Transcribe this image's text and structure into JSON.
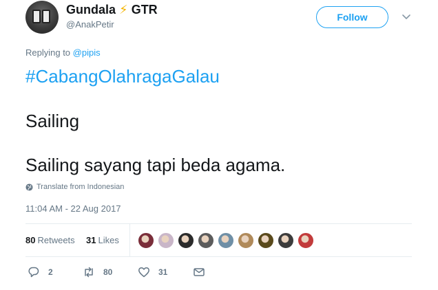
{
  "author": {
    "name": "Gundala",
    "emoji": "⚡",
    "name_suffix": "GTR",
    "handle": "@AnakPetir"
  },
  "follow_label": "Follow",
  "replying": {
    "prefix": "Replying to",
    "mention": "@pipis"
  },
  "tweet": {
    "hashtag": "#CabangOlahragaGalau",
    "line1": "Sailing",
    "line2": "Sailing sayang tapi beda agama."
  },
  "translate_label": "Translate from Indonesian",
  "timestamp": "11:04 AM - 22 Aug 2017",
  "stats": {
    "retweets_count": "80",
    "retweets_label": "Retweets",
    "likes_count": "31",
    "likes_label": "Likes"
  },
  "likers": [
    {
      "color": "#7a2e3a"
    },
    {
      "color": "#c9b6c8"
    },
    {
      "color": "#2b2b2b"
    },
    {
      "color": "#5c5c5c"
    },
    {
      "color": "#6f8fa6"
    },
    {
      "color": "#b08a5a"
    },
    {
      "color": "#5a4a1c"
    },
    {
      "color": "#3c3c3c"
    },
    {
      "color": "#c23b3b"
    }
  ],
  "actions": {
    "replies": "2",
    "retweets": "80",
    "likes": "31"
  },
  "icons": {
    "reply": "reply-icon",
    "retweet": "retweet-icon",
    "like": "heart-icon",
    "dm": "envelope-icon",
    "caret": "chevron-down-icon",
    "globe": "globe-icon"
  },
  "colors": {
    "accent": "#1da1f2",
    "muted": "#657786",
    "text": "#14171a",
    "divider": "#e6ecf0"
  }
}
